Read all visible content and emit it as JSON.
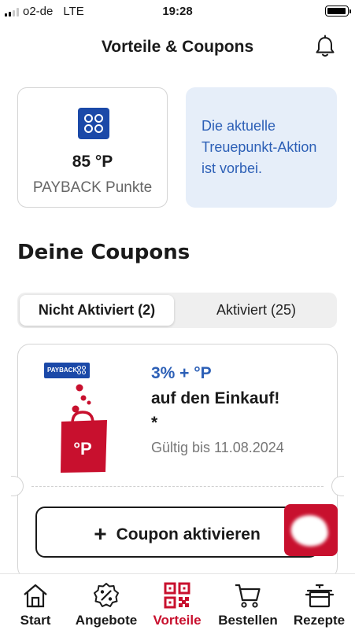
{
  "status_bar": {
    "carrier": "o2-de",
    "network": "LTE",
    "time": "19:28",
    "signal_bars": 2
  },
  "header": {
    "title": "Vorteile & Coupons",
    "icon": "bell-icon"
  },
  "points_card": {
    "value": "85 °P",
    "label": "PAYBACK Punkte",
    "icon": "payback-logo"
  },
  "promo_card": {
    "text": "Die aktuelle Treuepunkt-Aktion ist vorbei."
  },
  "coupons": {
    "section_title": "Deine Coupons",
    "tabs": [
      {
        "label": "Nicht Aktiviert (2)",
        "active": true
      },
      {
        "label": "Aktiviert (25)",
        "active": false
      }
    ],
    "items": [
      {
        "badge": "PAYBACK",
        "headline": "3% + °P",
        "subline": "auf den Einkauf!",
        "note": "*",
        "validity": "Gültig bis 11.08.2024",
        "bag_label": "°P",
        "action_label": "Coupon aktivieren"
      }
    ]
  },
  "tab_bar": {
    "items": [
      {
        "label": "Start",
        "icon": "house-icon",
        "selected": false
      },
      {
        "label": "Angebote",
        "icon": "percent-badge-icon",
        "selected": false
      },
      {
        "label": "Vorteile",
        "icon": "qr-code-icon",
        "selected": true
      },
      {
        "label": "Bestellen",
        "icon": "cart-icon",
        "selected": false
      },
      {
        "label": "Rezepte",
        "icon": "pot-icon",
        "selected": false
      }
    ]
  },
  "colors": {
    "brand_red": "#c8102e",
    "payback_blue": "#1b49a8",
    "accent_blue": "#2c5fb6",
    "promo_bg": "#e6eef9"
  }
}
